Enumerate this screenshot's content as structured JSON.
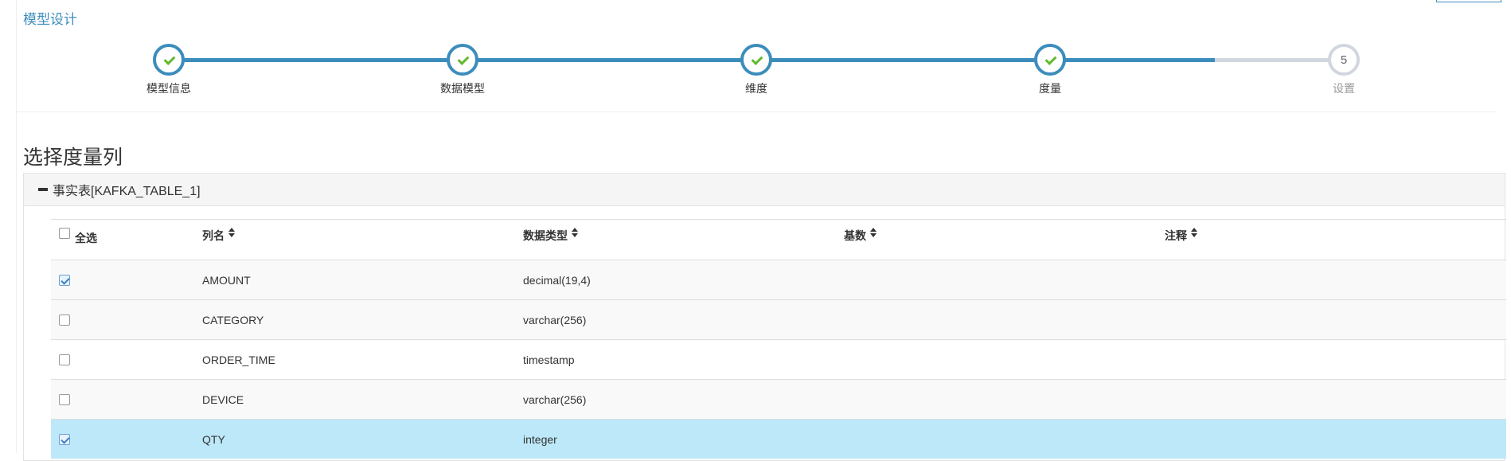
{
  "page_title": "模型设计",
  "wizard": {
    "steps": [
      {
        "label": "模型信息",
        "status": "done"
      },
      {
        "label": "数据模型",
        "status": "done"
      },
      {
        "label": "维度",
        "status": "done"
      },
      {
        "label": "度量",
        "status": "done"
      },
      {
        "label": "设置",
        "status": "todo",
        "number": "5"
      }
    ]
  },
  "section_title": "选择度量列",
  "panel": {
    "title": "事实表[KAFKA_TABLE_1]",
    "table": {
      "select_all_label": "全选",
      "columns": [
        "列名",
        "数据类型",
        "基数",
        "注释"
      ],
      "rows": [
        {
          "name": "AMOUNT",
          "type": "decimal(19,4)",
          "cardinality": "",
          "comment": "",
          "checked": true
        },
        {
          "name": "CATEGORY",
          "type": "varchar(256)",
          "cardinality": "",
          "comment": "",
          "checked": false
        },
        {
          "name": "ORDER_TIME",
          "type": "timestamp",
          "cardinality": "",
          "comment": "",
          "checked": false
        },
        {
          "name": "DEVICE",
          "type": "varchar(256)",
          "cardinality": "",
          "comment": "",
          "checked": false
        },
        {
          "name": "QTY",
          "type": "integer",
          "cardinality": "",
          "comment": "",
          "checked": true
        }
      ]
    }
  },
  "colors": {
    "accent": "#3c8dbc",
    "pending": "#d2d6de",
    "check": "#62b92e",
    "selected_row": "#bce8f9"
  }
}
